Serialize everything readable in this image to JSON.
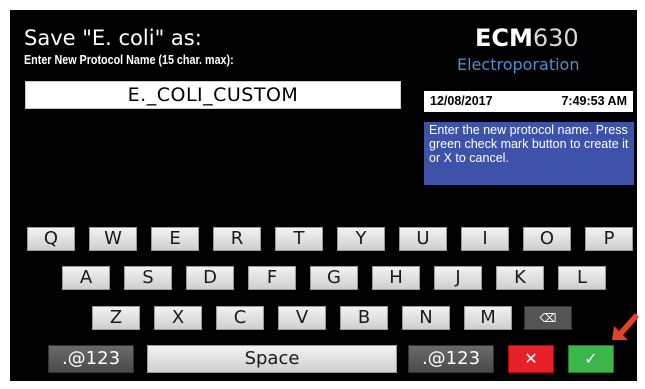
{
  "header": {
    "title": "Save \"E. coli\" as:",
    "prompt": "Enter New Protocol Name (15 char. max):",
    "name_value": "E._COLI_CUSTOM"
  },
  "brand": {
    "model_bold": "ECM",
    "model_num": "630",
    "subtitle": "Electroporation"
  },
  "status": {
    "date": "12/08/2017",
    "time": "7:49:53 AM"
  },
  "info_text": "Enter the new protocol name. Press green check mark button to create it or X to cancel.",
  "keyboard": {
    "row1": [
      "Q",
      "W",
      "E",
      "R",
      "T",
      "Y",
      "U",
      "I",
      "O",
      "P"
    ],
    "row2": [
      "A",
      "S",
      "D",
      "F",
      "G",
      "H",
      "J",
      "K",
      "L"
    ],
    "row3": [
      "Z",
      "X",
      "C",
      "V",
      "B",
      "N",
      "M"
    ],
    "backspace_glyph": "⌫",
    "symbols_label": ".@123",
    "space_label": "Space",
    "cancel_glyph": "✕",
    "confirm_glyph": "✓"
  },
  "colors": {
    "info_bg": "#3d52a8",
    "cancel": "#e8202a",
    "confirm": "#3cb54a",
    "pointer_arrow": "#e8402a"
  }
}
